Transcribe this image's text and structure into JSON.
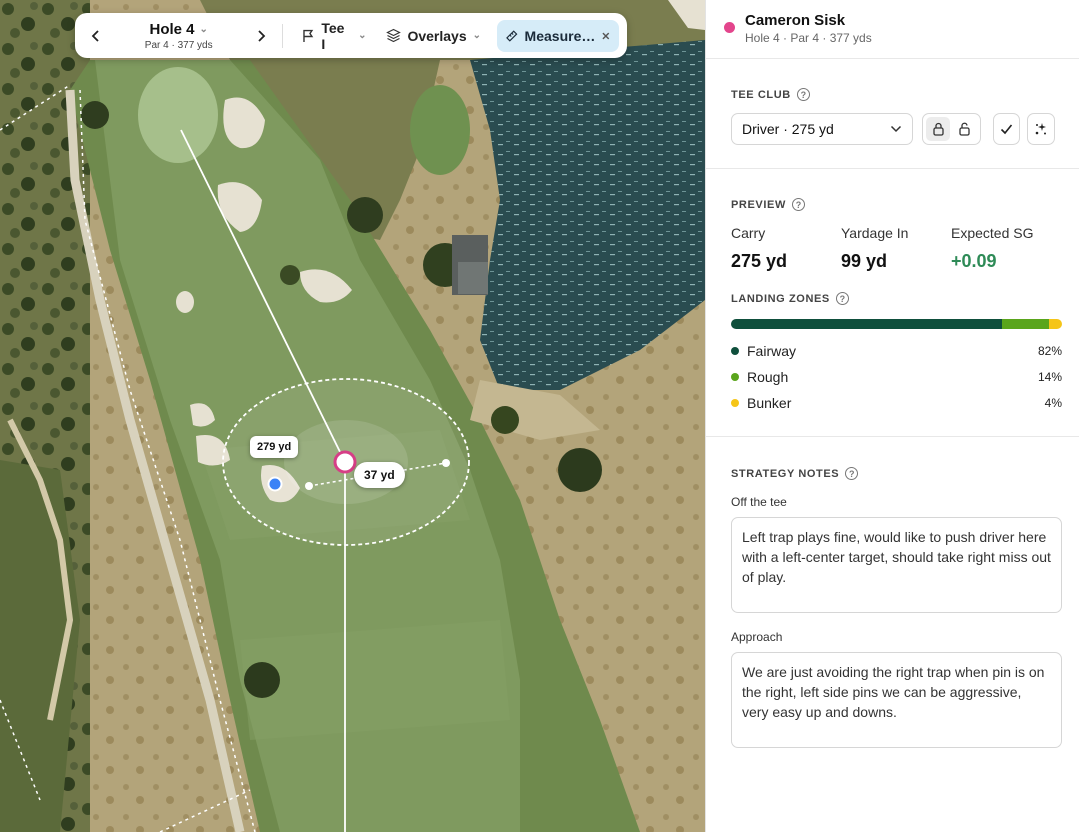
{
  "toolbar": {
    "hole_title": "Hole 4",
    "hole_subtitle": "Par 4 · 377 yds",
    "tee_label": "Tee I",
    "overlays_label": "Overlays",
    "measure_label": "Measure…"
  },
  "map": {
    "measure_label_1": "279 yd",
    "measure_label_2": "37 yd"
  },
  "player": {
    "name": "Cameron Sisk",
    "subtitle": "Hole 4 · Par 4 · 377 yds",
    "color": "#e3458c"
  },
  "tee_club": {
    "heading": "TEE CLUB",
    "selected": "Driver · 275 yd"
  },
  "preview": {
    "heading": "PREVIEW",
    "stats": [
      {
        "label": "Carry",
        "value": "275 yd"
      },
      {
        "label": "Yardage In",
        "value": "99 yd"
      },
      {
        "label": "Expected SG",
        "value": "+0.09"
      }
    ]
  },
  "landing_zones": {
    "heading": "LANDING ZONES",
    "zones": [
      {
        "name": "Fairway",
        "pct": "82%",
        "fraction": 0.82,
        "color": "#0f4f3c"
      },
      {
        "name": "Rough",
        "pct": "14%",
        "fraction": 0.14,
        "color": "#5aa51c"
      },
      {
        "name": "Bunker",
        "pct": "4%",
        "fraction": 0.04,
        "color": "#f5c518"
      }
    ]
  },
  "strategy": {
    "heading": "STRATEGY NOTES",
    "off_tee_label": "Off the tee",
    "off_tee_text": "Left trap plays fine, would like to push driver here with a left-center target, should take right miss out of play.",
    "approach_label": "Approach",
    "approach_text": "We are just avoiding the right trap when pin is on the right, left side pins we can be aggressive, very easy up and downs."
  }
}
